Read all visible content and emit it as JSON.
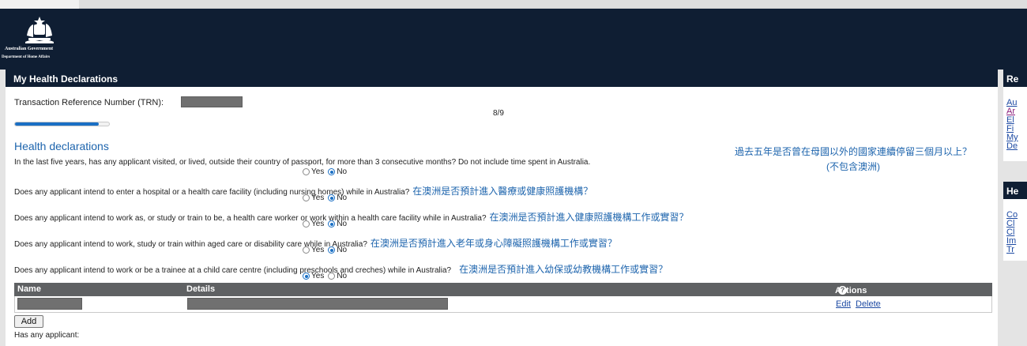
{
  "header": {
    "gov_name": "Australian Government",
    "dept_name": "Department of Home Affairs"
  },
  "main": {
    "title": "My Health Declarations",
    "trn_label": "Transaction Reference Number (TRN):",
    "page_indicator": "8/9",
    "progress_fraction": 0.89,
    "section_heading": "Health declarations",
    "annotation_line1": "過去五年是否曾在母國以外的國家連續停留三個月以上？",
    "annotation_line2": "(不包含澳洲)",
    "yes_label": "Yes",
    "no_label": "No",
    "questions": [
      {
        "text": "In the last five years, has any applicant visited, or lived, outside their country of passport, for more than 3 consecutive months? Do not include time spent in Australia.",
        "cn": "",
        "answer": "No"
      },
      {
        "text": "Does any applicant intend to enter a hospital or a health care facility (including nursing homes) while in Australia?",
        "cn": "在澳洲是否預計進入醫療或健康照護機構？",
        "answer": "No"
      },
      {
        "text": "Does any applicant intend to work as, or study or train to be, a health care worker or work within a health care facility while in Australia?",
        "cn": "在澳洲是否預計進入健康照護機構工作或實習？",
        "answer": "No"
      },
      {
        "text": "Does any applicant intend to work, study or train within aged care or disability care while in Australia?",
        "cn": "在澳洲是否預計進入老年或身心障礙照護機構工作或實習？",
        "answer": "No"
      },
      {
        "text": "Does any applicant intend to work or be a trainee at a child care centre (including preschools and creches) while in Australia?",
        "cn": "在澳洲是否預計進入幼保或幼教機構工作或實習？",
        "answer": "Yes"
      }
    ],
    "table": {
      "col_name": "Name",
      "col_details": "Details",
      "col_actions": "Actions",
      "edit_label": "Edit",
      "delete_label": "Delete"
    },
    "add_label": "Add",
    "has_applicant": "Has any applicant:"
  },
  "sidebar": {
    "panel1_title": "Re",
    "panel1_links": [
      "Au",
      "Ar",
      "El",
      "Fi",
      "My",
      "De"
    ],
    "panel2_title": "He",
    "panel2_links": [
      "Co",
      "Cl",
      "Cl",
      "Im",
      "Tr"
    ]
  }
}
